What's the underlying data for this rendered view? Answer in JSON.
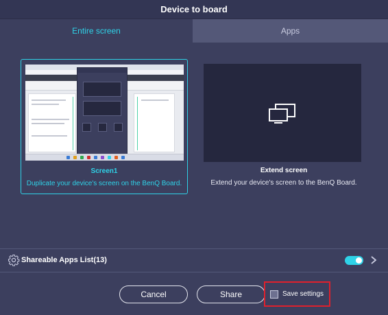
{
  "window": {
    "title": "Device to board"
  },
  "tabs": [
    {
      "label": "Entire screen",
      "active": true
    },
    {
      "label": "Apps",
      "active": false
    }
  ],
  "screens": [
    {
      "title": "Screen1",
      "description": "Duplicate your device's screen on the BenQ Board.",
      "selected": true
    },
    {
      "title": "Extend screen",
      "description": "Extend your device's screen to the BenQ Board.",
      "selected": false,
      "icon": "extend-screen-icon"
    }
  ],
  "apps_list": {
    "label": "Shareable Apps List(13)",
    "icon": "gear-icon",
    "toggle_on": true
  },
  "buttons": {
    "cancel": "Cancel",
    "share": "Share"
  },
  "save_settings": {
    "label": "Save settings",
    "checked": false
  },
  "colors": {
    "accent": "#2fd3e8",
    "background": "#3c3f5e",
    "highlight_box": "#e0202c"
  }
}
